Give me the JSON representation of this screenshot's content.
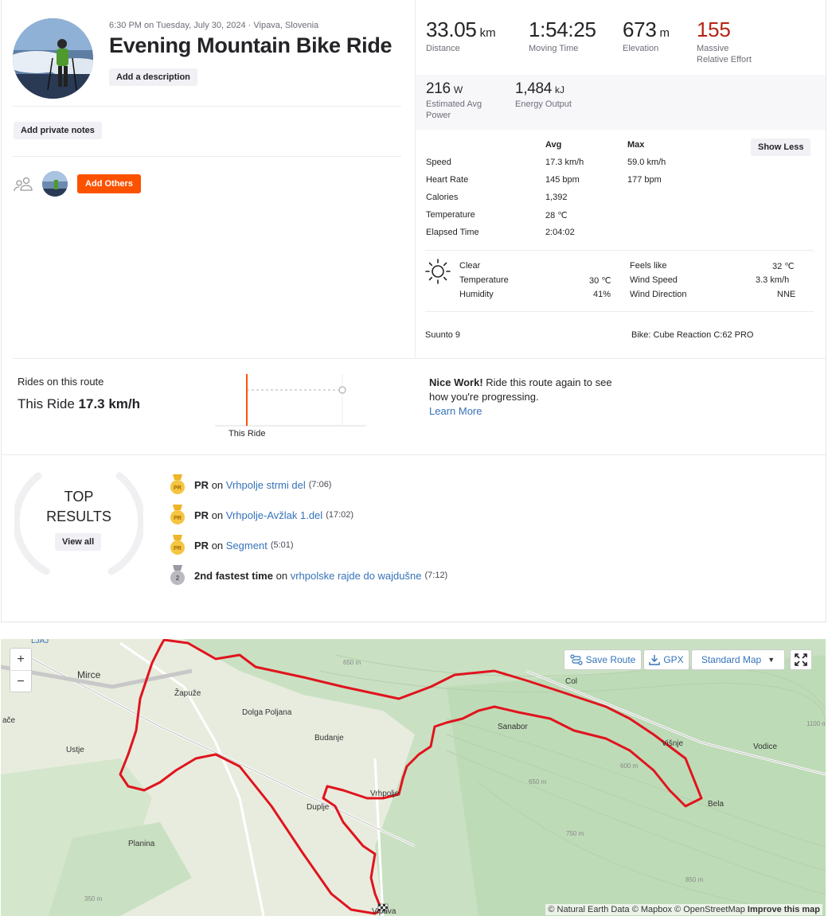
{
  "activity": {
    "meta": "6:30 PM on Tuesday, July 30, 2024 · Vipava, Slovenia",
    "title": "Evening Mountain Bike Ride",
    "add_description": "Add a description",
    "add_private_notes": "Add private notes",
    "add_others": "Add Others"
  },
  "stats": {
    "distance": {
      "value": "33.05",
      "unit": "km",
      "label": "Distance"
    },
    "moving_time": {
      "value": "1:54:25",
      "label": "Moving Time"
    },
    "elevation": {
      "value": "673",
      "unit": "m",
      "label": "Elevation"
    },
    "relative_effort": {
      "value": "155",
      "label1": "Massive",
      "label2": "Relative Effort"
    },
    "power": {
      "value": "216",
      "unit": "W",
      "label1": "Estimated Avg",
      "label2": "Power"
    },
    "energy": {
      "value": "1,484",
      "unit": "kJ",
      "label": "Energy Output"
    }
  },
  "details": {
    "head_avg": "Avg",
    "head_max": "Max",
    "show_less": "Show Less",
    "rows": [
      {
        "label": "Speed",
        "avg": "17.3 km/h",
        "max": "59.0 km/h"
      },
      {
        "label": "Heart Rate",
        "avg": "145 bpm",
        "max": "177 bpm"
      },
      {
        "label": "Calories",
        "avg": "1,392",
        "max": ""
      },
      {
        "label": "Temperature",
        "avg": "28 ℃",
        "max": ""
      },
      {
        "label": "Elapsed Time",
        "avg": "2:04:02",
        "max": ""
      }
    ]
  },
  "weather": {
    "condition": "Clear",
    "temperature_label": "Temperature",
    "temperature": "30 ℃",
    "humidity_label": "Humidity",
    "humidity": "41%",
    "feels_like_label": "Feels like",
    "feels_like": "32 ℃",
    "wind_speed_label": "Wind Speed",
    "wind_speed": "3.3 km/h",
    "wind_direction_label": "Wind Direction",
    "wind_direction": "NNE"
  },
  "device": "Suunto 9",
  "bike": "Bike: Cube Reaction C:62 PRO",
  "route": {
    "label": "Rides on this route",
    "value_prefix": "This Ride",
    "value": "17.3 km/h",
    "chart_label": "This Ride",
    "nice_bold": "Nice Work!",
    "nice_text": " Ride this route again to see how you're progressing.",
    "learn_more": "Learn More"
  },
  "top_results": {
    "title1": "TOP",
    "title2": "RESULTS",
    "view_all": "View all",
    "items": [
      {
        "prefix": "PR",
        "on": "on",
        "segment": "Vrhpolje strmi del",
        "time": "(7:06)",
        "badge": "gold"
      },
      {
        "prefix": "PR",
        "on": "on",
        "segment": "Vrhpolje-Avžlak 1.del",
        "time": "(17:02)",
        "badge": "gold"
      },
      {
        "prefix": "PR",
        "on": "on",
        "segment": "Segment",
        "time": "(5:01)",
        "badge": "gold"
      },
      {
        "prefix": "2nd fastest time",
        "on": "on",
        "segment": "vrhpolske rajde do wajdušne",
        "time": "(7:12)",
        "badge": "silver"
      }
    ]
  },
  "map": {
    "save_route": "Save Route",
    "gpx": "GPX",
    "map_type": "Standard Map",
    "zoom_in": "+",
    "zoom_out": "−",
    "attribution": "© Natural Earth Data © Mapbox © OpenStreetMap",
    "improve": "Improve this map",
    "places": [
      "LJAJ",
      "Mirce",
      "Žapuže",
      "Dolga Poljana",
      "Budanje",
      "Col",
      "Sanabor",
      "Vrhpolje",
      "Duplje",
      "Ustje",
      "Planina",
      "Višnje",
      "Bela",
      "Vodice",
      "Vipava",
      "ače"
    ],
    "contours": [
      "650 m",
      "600 m",
      "650 m",
      "750 m",
      "850 m",
      "1100 m",
      "350 m"
    ],
    "route_color": "#e0141e"
  }
}
